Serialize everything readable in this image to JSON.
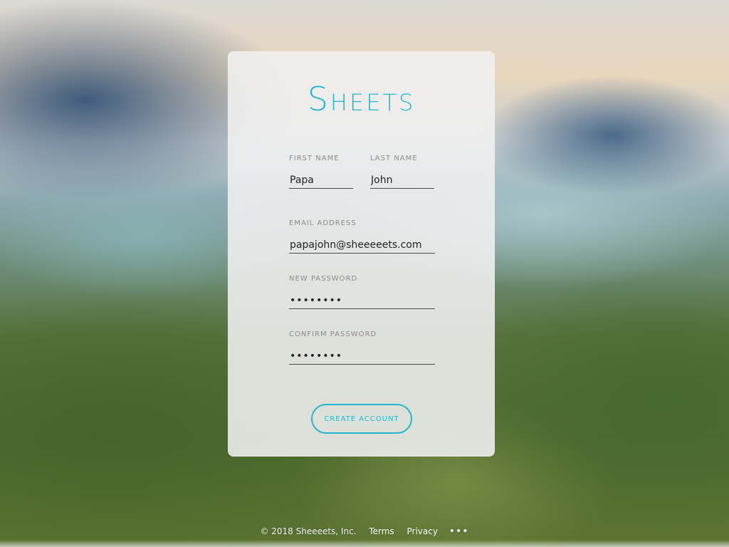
{
  "app": {
    "logo": "Sheets",
    "brand_color": "#21b8cf"
  },
  "form": {
    "first_name": {
      "label": "First Name",
      "value": "Papa"
    },
    "last_name": {
      "label": "Last Name",
      "value": "John"
    },
    "email": {
      "label": "Email Address",
      "value": "papajohn@sheeeeets.com"
    },
    "new_password": {
      "label": "New Password",
      "value": "••••••••"
    },
    "confirm_password": {
      "label": "Confirm Password",
      "value": "••••••••"
    },
    "submit_label": "Create Account"
  },
  "footer": {
    "copyright": "© 2018 Sheeeets, Inc.",
    "links": [
      "Terms",
      "Privacy"
    ],
    "more_icon": "more-horizontal-icon",
    "more_glyph": "•••"
  }
}
